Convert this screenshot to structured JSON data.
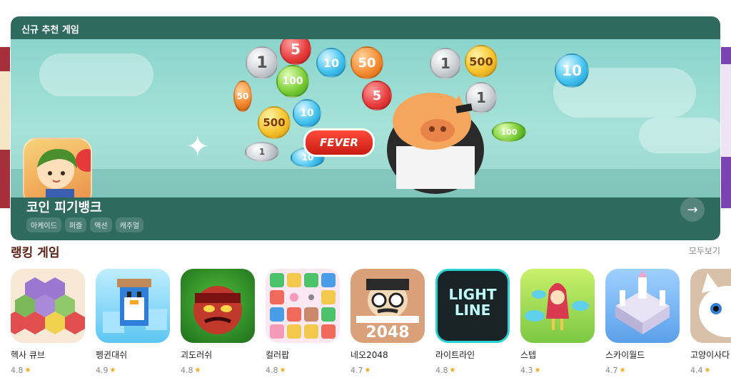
{
  "hero": {
    "section_label": "신규 추천 게임",
    "title": "코인 피기뱅크",
    "tags": [
      "아케이드",
      "퍼즐",
      "액션",
      "캐주얼"
    ],
    "art_text": {
      "fever": "FEVER",
      "coins": [
        "1",
        "5",
        "10",
        "50",
        "1",
        "500",
        "100",
        "5",
        "1",
        "50",
        "500",
        "10",
        "1",
        "10",
        "100",
        "10"
      ]
    }
  },
  "ranking": {
    "title": "랭킹 게임",
    "see_all": "모두보기",
    "games": [
      {
        "name": "헥사 큐브",
        "rating": "4.8",
        "art_text": ""
      },
      {
        "name": "펭귄대쉬",
        "rating": "4.9",
        "art_text": ""
      },
      {
        "name": "괴도러쉬",
        "rating": "4.8",
        "art_text": ""
      },
      {
        "name": "컬러팝",
        "rating": "4.8",
        "art_text": ""
      },
      {
        "name": "네오2048",
        "rating": "4.7",
        "art_text": "2048"
      },
      {
        "name": "라이트라인",
        "rating": "4.8",
        "art_text": "LIGHT LINE"
      },
      {
        "name": "스텝",
        "rating": "4.3",
        "art_text": ""
      },
      {
        "name": "스카이월드",
        "rating": "4.7",
        "art_text": ""
      },
      {
        "name": "고양이사다",
        "rating": "4.4",
        "art_text": ""
      }
    ]
  },
  "colors": {
    "hero_bg": "#2f6a5f",
    "rank_title": "#5a1f12",
    "star": "#f2a81c"
  },
  "icons": [
    "arrow-right-icon",
    "star-icon"
  ]
}
